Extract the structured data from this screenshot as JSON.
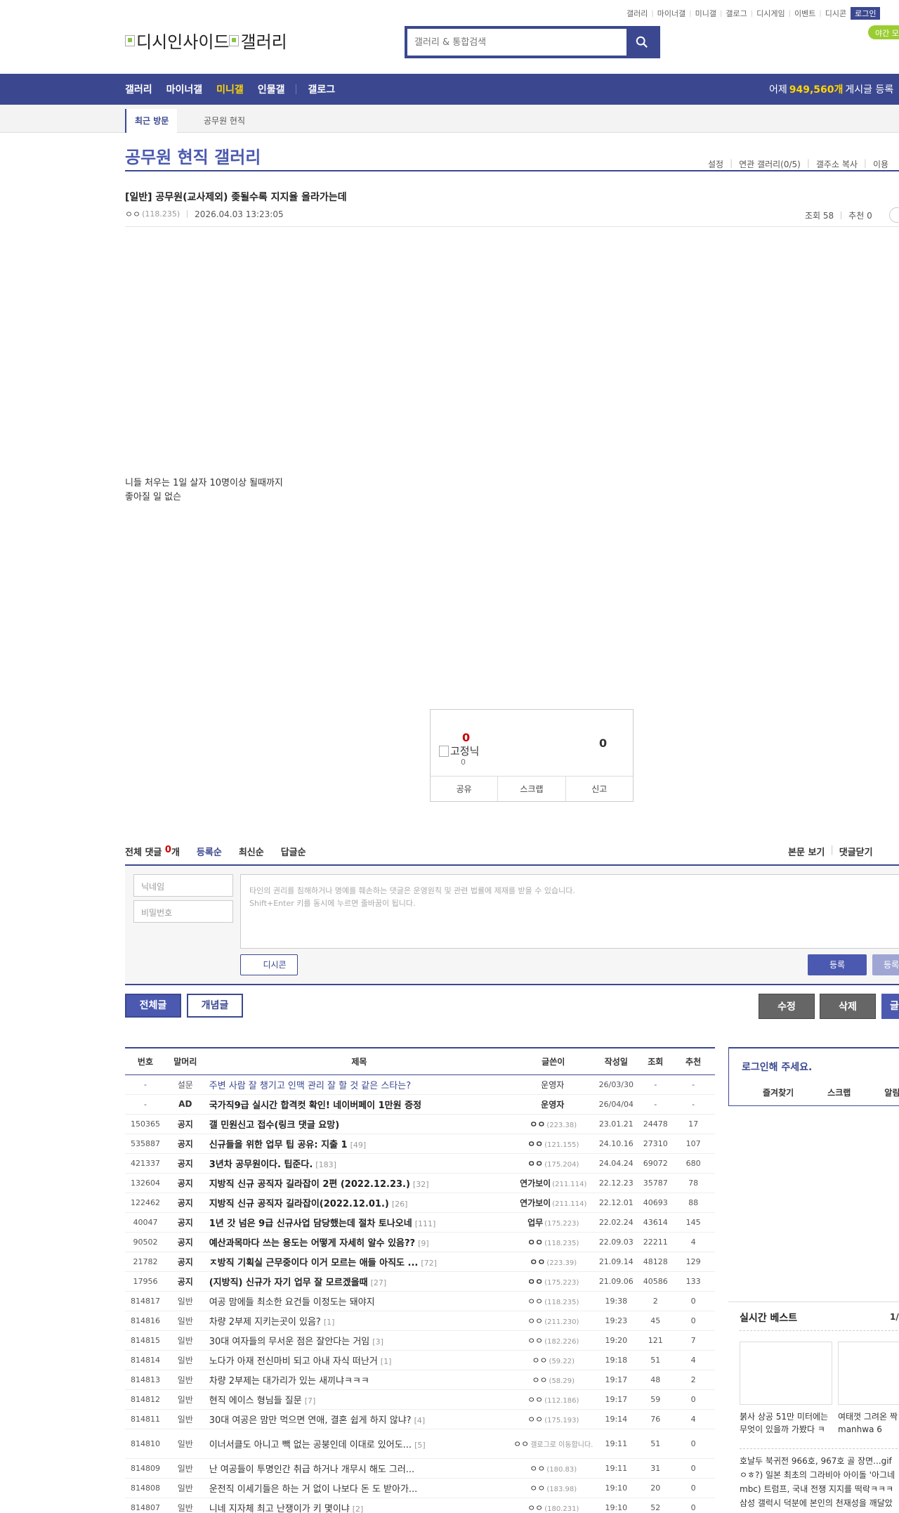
{
  "topnav": {
    "links": [
      "갤러리",
      "마이너갤",
      "미니갤",
      "갤로그",
      "디시게임",
      "이벤트",
      "디시콘"
    ],
    "login": "로그인"
  },
  "night_mode": "야간 모",
  "logo": {
    "brand": "디시인사이드",
    "section": "갤러리"
  },
  "search": {
    "placeholder": "갤러리 & 통합검색"
  },
  "gnb": {
    "items": [
      "갤러리",
      "마이너갤",
      "미니갤",
      "인물갤",
      "갤로그"
    ],
    "active_index": 2,
    "stats_prefix": "어제",
    "stats_count": "949,560개",
    "stats_suffix": "게시글 등록"
  },
  "subbar": {
    "recent_label": "최근 방문",
    "recent_item": "공무원 현직"
  },
  "gallery": {
    "title": "공무원 현직 갤러리",
    "tools": [
      "설정",
      "연관 갤러리(0/5)",
      "갤주소 복사",
      "이용"
    ]
  },
  "post": {
    "title": "[일반] 공무원(교사제외) 좆될수록 지지율 올라가는데",
    "author": "ㅇㅇ",
    "ip": "(118.235)",
    "date": "2026.04.03 13:23:05",
    "views_label": "조회 58",
    "recommend_label": "추천 0",
    "body_lines": [
      "니들 처우는 1일 살자 10명이상 될때까지",
      "좋아질 일 없슨"
    ]
  },
  "recommend": {
    "up": "0",
    "fixed_label": "고정닉",
    "fixed_count": "0",
    "down": "0",
    "actions": [
      "공유",
      "스크랩",
      "신고"
    ]
  },
  "comments": {
    "label": "전체 댓글",
    "count": "0",
    "unit": "개",
    "sorts": [
      "등록순",
      "최신순",
      "답글순"
    ],
    "right": [
      "본문 보기",
      "댓글닫기"
    ],
    "nick_placeholder": "닉네임",
    "pw_placeholder": "비밀번호",
    "notice_line1": "타인의 권리를 침해하거나 명예를 훼손하는 댓글은 운영원칙 및 관련 법률에 제재를 받을 수 있습니다.",
    "notice_line2": "Shift+Enter 키를 동시에 누르면 줄바꿈이 됩니다.",
    "dccon": "디시콘",
    "submit": "등록",
    "submit2": "등록"
  },
  "buttons": {
    "all": "전체글",
    "concept": "개념글",
    "edit": "수정",
    "delete": "삭제",
    "write": "글"
  },
  "list": {
    "headers": [
      "번호",
      "말머리",
      "제목",
      "글쓴이",
      "작성일",
      "조회",
      "추천"
    ],
    "rows": [
      {
        "no": "-",
        "head": "설문",
        "subject": "주변 사람 잘 챙기고 인맥 관리 잘 할 것 같은 스타는?",
        "reply": "",
        "writer": "운영자",
        "ip": "",
        "date": "26/03/30",
        "views": "-",
        "rec": "-",
        "type": "survey"
      },
      {
        "no": "-",
        "head": "AD",
        "subject": "국가직9급 실시간 합격컷 확인! 네이버페이 1만원 증정",
        "reply": "",
        "writer": "운영자",
        "ip": "",
        "date": "26/04/04",
        "views": "-",
        "rec": "-",
        "type": "notice"
      },
      {
        "no": "150365",
        "head": "공지",
        "subject": "갤 민원신고 접수(링크 댓글 요망)",
        "reply": "",
        "writer": "ㅇㅇ",
        "ip": "(223.38)",
        "date": "23.01.21",
        "views": "24478",
        "rec": "17",
        "type": "notice"
      },
      {
        "no": "535887",
        "head": "공지",
        "subject": "신규들을 위한 업무 팁 공유: 지출 1",
        "reply": "[49]",
        "writer": "ㅇㅇ",
        "ip": "(121.155)",
        "date": "24.10.16",
        "views": "27310",
        "rec": "107",
        "type": "notice"
      },
      {
        "no": "421337",
        "head": "공지",
        "subject": "3년차 공무원이다. 팁준다.",
        "reply": "[183]",
        "writer": "ㅇㅇ",
        "ip": "(175.204)",
        "date": "24.04.24",
        "views": "69072",
        "rec": "680",
        "type": "notice"
      },
      {
        "no": "132604",
        "head": "공지",
        "subject": "지방직 신규 공직자 길라잡이 2편 (2022.12.23.)",
        "reply": "[32]",
        "writer": "연가보이",
        "ip": "(211.114)",
        "date": "22.12.23",
        "views": "35787",
        "rec": "78",
        "type": "notice"
      },
      {
        "no": "122462",
        "head": "공지",
        "subject": "지방직 신규 공직자 길라잡이(2022.12.01.)",
        "reply": "[26]",
        "writer": "연가보이",
        "ip": "(211.114)",
        "date": "22.12.01",
        "views": "40693",
        "rec": "88",
        "type": "notice"
      },
      {
        "no": "40047",
        "head": "공지",
        "subject": "1년 갓 넘은 9급 신규사업 담당했는데 절차 토나오네",
        "reply": "[111]",
        "writer": "업무",
        "ip": "(175.223)",
        "date": "22.02.24",
        "views": "43614",
        "rec": "145",
        "type": "notice"
      },
      {
        "no": "90502",
        "head": "공지",
        "subject": "예산과목마다 쓰는 용도는 어떻게 자세히 알수 있음??",
        "reply": "[9]",
        "writer": "ㅇㅇ",
        "ip": "(118.235)",
        "date": "22.09.03",
        "views": "22211",
        "rec": "4",
        "type": "notice"
      },
      {
        "no": "21782",
        "head": "공지",
        "subject": "ㅈ방직 기획실 근무중이다 이거 모르는 애들 아직도 ...",
        "reply": "[72]",
        "writer": "ㅇㅇ",
        "ip": "(223.39)",
        "date": "21.09.14",
        "views": "48128",
        "rec": "129",
        "type": "notice"
      },
      {
        "no": "17956",
        "head": "공지",
        "subject": "(지방직) 신규가 자기 업무 잘 모르겠을때",
        "reply": "[27]",
        "writer": "ㅇㅇ",
        "ip": "(175.223)",
        "date": "21.09.06",
        "views": "40586",
        "rec": "133",
        "type": "notice"
      },
      {
        "no": "814817",
        "head": "일반",
        "subject": "여공 맘에들 최소한 요건들 이정도는 돼야지",
        "reply": "",
        "writer": "ㅇㅇ",
        "ip": "(118.235)",
        "date": "19:38",
        "views": "2",
        "rec": "0",
        "type": "normal"
      },
      {
        "no": "814816",
        "head": "일반",
        "subject": "차량 2부제 지키는곳이 있음?",
        "reply": "[1]",
        "writer": "ㅇㅇ",
        "ip": "(211.230)",
        "date": "19:23",
        "views": "45",
        "rec": "0",
        "type": "normal"
      },
      {
        "no": "814815",
        "head": "일반",
        "subject": "30대 여자들의 무서운 점은 잘안다는 거임",
        "reply": "[3]",
        "writer": "ㅇㅇ",
        "ip": "(182.226)",
        "date": "19:20",
        "views": "121",
        "rec": "7",
        "type": "normal"
      },
      {
        "no": "814814",
        "head": "일반",
        "subject": "노다가 아재 전신마비 되고 아내 자식 떠난거",
        "reply": "[1]",
        "writer": "ㅇㅇ",
        "ip": "(59.22)",
        "date": "19:18",
        "views": "51",
        "rec": "4",
        "type": "normal"
      },
      {
        "no": "814813",
        "head": "일반",
        "subject": "차량 2부제는 대가리가 있는 새끼냐ㅋㅋㅋ",
        "reply": "",
        "writer": "ㅇㅇ",
        "ip": "(58.29)",
        "date": "19:17",
        "views": "48",
        "rec": "2",
        "type": "normal"
      },
      {
        "no": "814812",
        "head": "일반",
        "subject": "현직 에이스 형님들 질문",
        "reply": "[7]",
        "writer": "ㅇㅇ",
        "ip": "(112.186)",
        "date": "19:17",
        "views": "59",
        "rec": "0",
        "type": "normal"
      },
      {
        "no": "814811",
        "head": "일반",
        "subject": "30대 여공은 맘만 먹으면 연애, 결혼 쉽게 하지 않냐?",
        "reply": "[4]",
        "writer": "ㅇㅇ",
        "ip": "(175.193)",
        "date": "19:14",
        "views": "76",
        "rec": "4",
        "type": "normal"
      },
      {
        "no": "814810",
        "head": "일반",
        "subject": "이너서클도 아니고 빽 없는 공붕인데 이대로 있어도...",
        "reply": "[5]",
        "writer": "ㅇㅇ",
        "ip": "",
        "writer_note": "갤로그로 이동합니다.",
        "date": "19:11",
        "views": "51",
        "rec": "0",
        "type": "normal tall"
      },
      {
        "no": "814809",
        "head": "일반",
        "subject": "난 여공들이 투명인간 취급 하거나 개무시 해도 그러...",
        "reply": "",
        "writer": "ㅇㅇ",
        "ip": "(180.83)",
        "date": "19:11",
        "views": "31",
        "rec": "0",
        "type": "normal"
      },
      {
        "no": "814808",
        "head": "일반",
        "subject": "운전직 이세기들은 하는 거 없이 나보다 돈 도 받아가...",
        "reply": "",
        "writer": "ㅇㅇ",
        "ip": "(183.98)",
        "date": "19:10",
        "views": "20",
        "rec": "0",
        "type": "normal"
      },
      {
        "no": "814807",
        "head": "일반",
        "subject": "니네 지자체 최고 난쟁이가 키 몇이냐",
        "reply": "[2]",
        "writer": "ㅇㅇ",
        "ip": "(180.231)",
        "date": "19:10",
        "views": "52",
        "rec": "0",
        "type": "normal"
      }
    ]
  },
  "sidebar": {
    "login_title": "로그인해 주세요.",
    "login_links": [
      "즐겨찾기",
      "스크랩",
      "알림"
    ],
    "best_title": "실시간 베스트",
    "best_page": "1/",
    "best_caption1": "붉사 상공 51만 미터에는 무엇이 있을까 가봤다 ㅋ",
    "best_caption2": "여태껏 그려온 짝 manhwa 6",
    "best_list": [
      "호날두 북귀전 966호, 967호 골 장면...gif",
      "ㅇㅎ?) 일본 최초의 그라비아 아이돌 '아그네",
      "mbc) 트럼프, 국내 전쟁 지지를 떡락ㅋㅋㅋ",
      "삼성 갤럭시 덕분에 본인의 천재성을 깨달았"
    ]
  }
}
